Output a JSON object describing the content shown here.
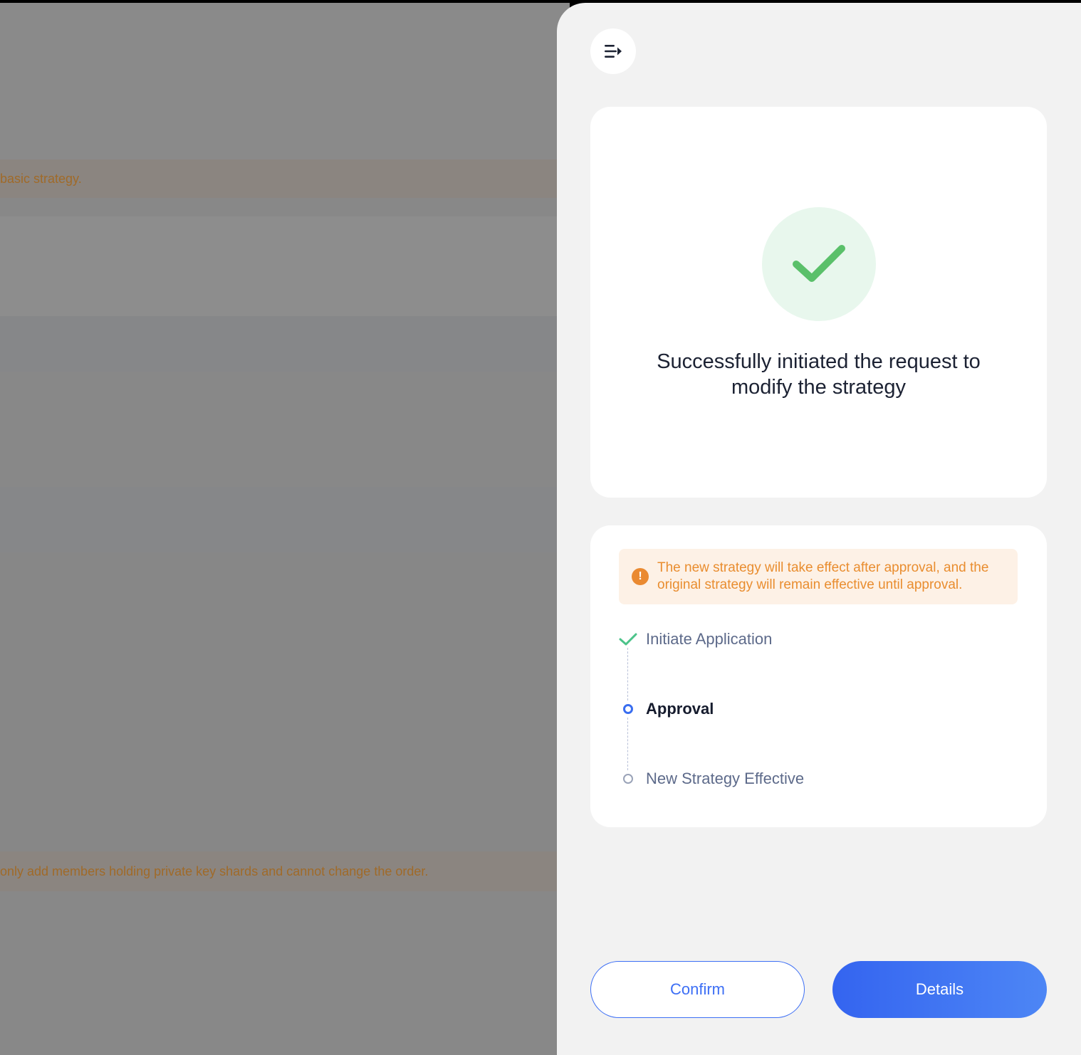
{
  "background": {
    "notice_top": "basic strategy.",
    "notice_bottom": "only add members holding private key shards and cannot change the order."
  },
  "drawer": {
    "collapse_icon": "collapse-drawer-icon",
    "success": {
      "icon": "check-icon",
      "title_line1": "Successfully initiated the request to",
      "title_line2": "modify the strategy"
    },
    "notice": {
      "icon": "warning-icon",
      "glyph": "!",
      "line1": "The new strategy will take effect after approval, and the",
      "line2": "original strategy will remain effective until approval."
    },
    "steps": [
      {
        "label": "Initiate Application",
        "status": "done"
      },
      {
        "label": "Approval",
        "status": "active"
      },
      {
        "label": "New Strategy Effective",
        "status": "pending"
      }
    ],
    "buttons": {
      "confirm": "Confirm",
      "details": "Details"
    }
  },
  "colors": {
    "primary": "#3d6ff5",
    "success": "#5ac06a",
    "warning": "#e98d2f",
    "overlay": "#878787"
  }
}
